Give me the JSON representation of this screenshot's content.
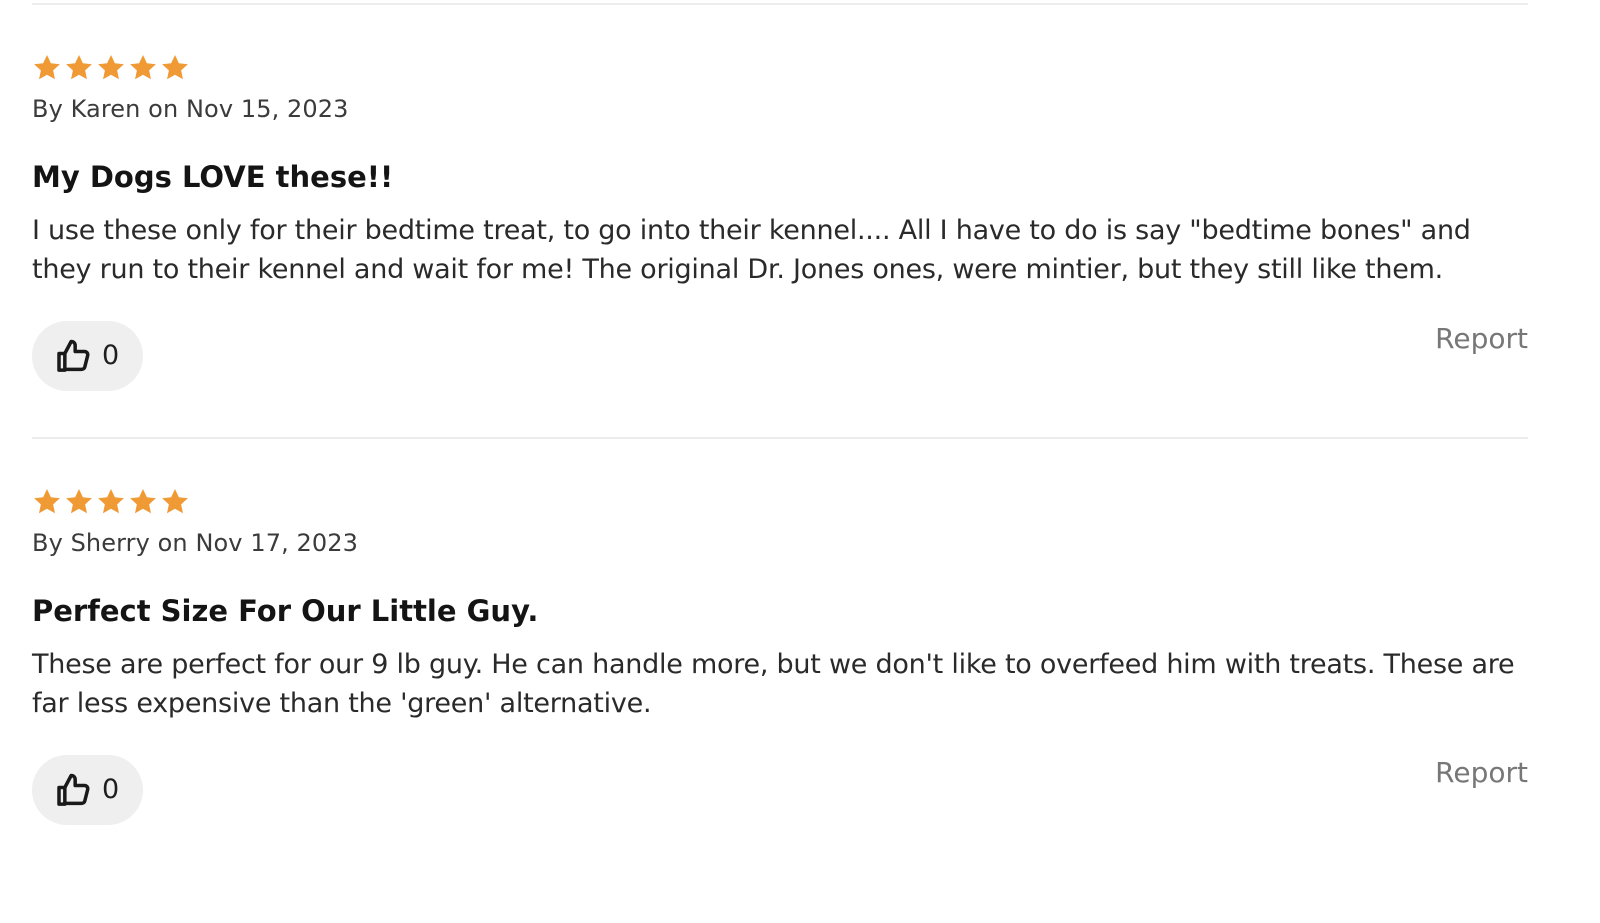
{
  "colors": {
    "star": "#f09a36",
    "divider": "#ececec",
    "like_button_bg": "#efefef",
    "report_text": "#777777"
  },
  "reviews": [
    {
      "rating": 5,
      "rating_max": 5,
      "star_icon": "star-filled-icon",
      "byline": "By Karen on Nov 15, 2023",
      "title": "My Dogs LOVE these!!",
      "body": "I use these only for their bedtime treat, to go into their kennel.... All I have to do is say \"bedtime bones\" and they run to their kennel and wait for me! The original Dr. Jones ones, were mintier, but they still like them.",
      "like_icon": "thumbs-up-icon",
      "likes": "0",
      "report_label": "Report"
    },
    {
      "rating": 5,
      "rating_max": 5,
      "star_icon": "star-filled-icon",
      "byline": "By Sherry on Nov 17, 2023",
      "title": "Perfect Size For Our Little Guy.",
      "body": "These are perfect for our 9 lb guy. He can handle more, but we don't like to overfeed him with treats. These are far less expensive than the 'green' alternative.",
      "like_icon": "thumbs-up-icon",
      "likes": "0",
      "report_label": "Report"
    }
  ]
}
